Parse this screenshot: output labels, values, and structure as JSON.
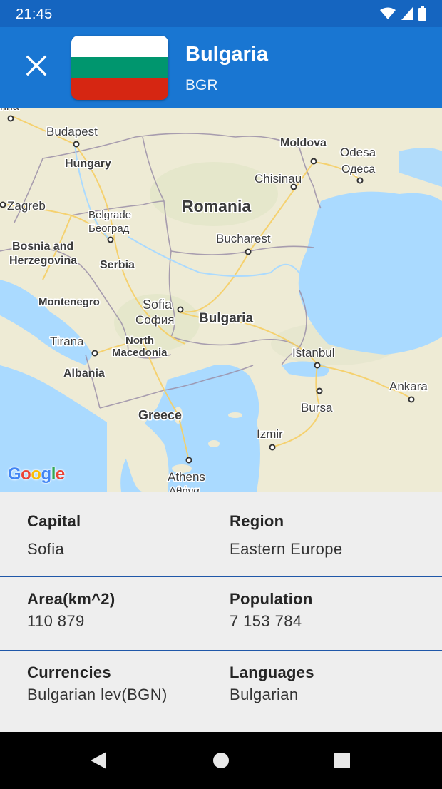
{
  "status_bar": {
    "time": "21:45",
    "icons": [
      "wifi-icon",
      "cellular-signal-icon",
      "battery-icon"
    ]
  },
  "app_bar": {
    "close_icon": "close-icon",
    "country_name": "Bulgaria",
    "country_code": "BGR",
    "flag_colors": [
      "#ffffff",
      "#00966e",
      "#d62612"
    ],
    "background": "#1976d2"
  },
  "map": {
    "labels": {
      "budapest": "Budapest",
      "hungary": "Hungary",
      "moldova": "Moldova",
      "odesa": "Odesa",
      "odesa_cyr": "Одеса",
      "chisinau": "Chisinau",
      "zagreb": "Zagreb",
      "romania": "Romania",
      "belgrade": "Belgrade",
      "belgrade_cyr": "Београд",
      "bucharest": "Bucharest",
      "bosnia_1": "Bosnia and",
      "bosnia_2": "Herzegovina",
      "serbia": "Serbia",
      "montenegro": "Montenegro",
      "sofia": "Sofia",
      "sofia_cyr": "София",
      "bulgaria": "Bulgaria",
      "tirana": "Tirana",
      "north_macedonia_1": "North",
      "north_macedonia_2": "Macedonia",
      "istanbul": "Istanbul",
      "albania": "Albania",
      "ankara": "Ankara",
      "bursa": "Bursa",
      "greece": "Greece",
      "izmir": "Izmir",
      "athens": "Athens",
      "athens_gr": "Αθήνα",
      "top_left_partial": "hna"
    },
    "attribution": "Google",
    "attribution_colors": [
      "#4285f4",
      "#ea4335",
      "#fbbc05",
      "#4285f4",
      "#34a853",
      "#ea4335"
    ]
  },
  "details": {
    "capital_label": "Capital",
    "capital_value": "Sofia",
    "region_label": "Region",
    "region_value": "Eastern Europe",
    "area_label": "Area(km^2)",
    "area_value": "110 879",
    "population_label": "Population",
    "population_value": "7 153 784",
    "currencies_label": "Currencies",
    "currencies_value": "Bulgarian lev(BGN)",
    "languages_label": "Languages",
    "languages_value": "Bulgarian"
  },
  "nav_bar": {
    "back_icon": "back-triangle-icon",
    "home_icon": "home-circle-icon",
    "recents_icon": "recents-square-icon"
  }
}
